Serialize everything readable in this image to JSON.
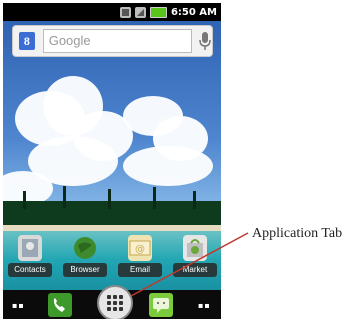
{
  "status_bar": {
    "time": "6:50 AM"
  },
  "search": {
    "logo_letter": "8",
    "placeholder": "Google"
  },
  "apps": [
    {
      "label": "Contacts",
      "icon": "contacts-icon"
    },
    {
      "label": "Browser",
      "icon": "browser-globe-icon"
    },
    {
      "label": "Email",
      "icon": "email-icon"
    },
    {
      "label": "Market",
      "icon": "market-icon"
    }
  ],
  "dock": {
    "left_dots": "▪▪",
    "right_dots": "▪▪"
  },
  "annotation": {
    "text": "Application Tab"
  },
  "colors": {
    "search_logo": "#3b6ed4",
    "phone_icon": "#3d9a2a",
    "message_icon": "#7ccb3c",
    "battery": "#5ac41d"
  }
}
